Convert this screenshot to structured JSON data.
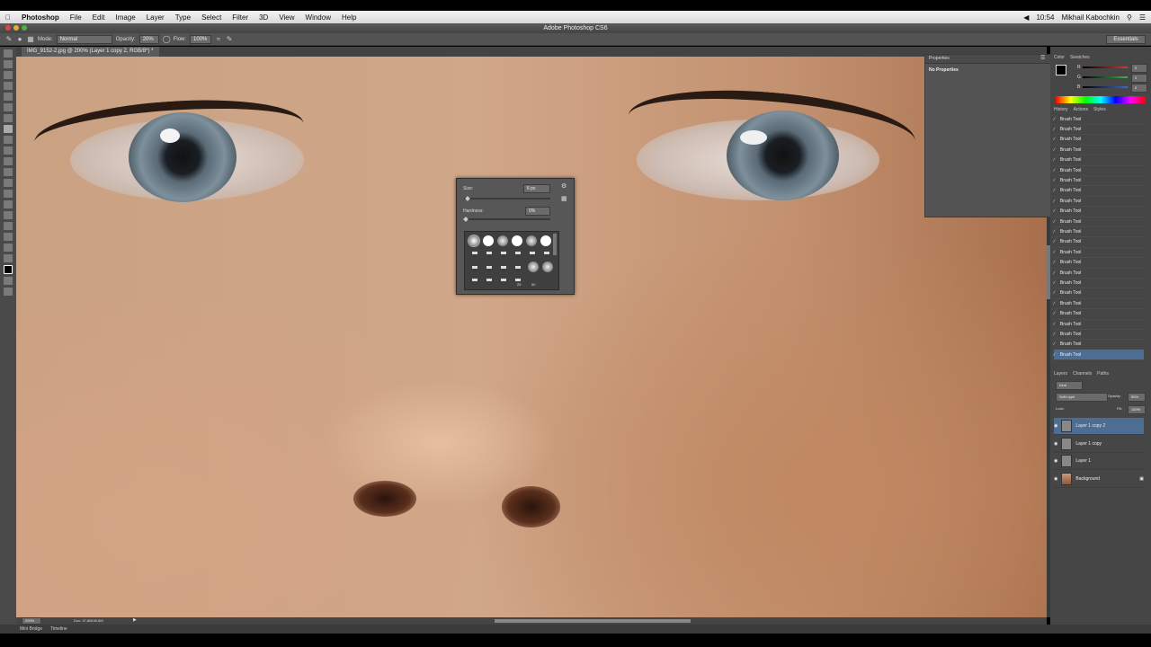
{
  "menubar": {
    "app": "Photoshop",
    "items": [
      "File",
      "Edit",
      "Image",
      "Layer",
      "Type",
      "Select",
      "Filter",
      "3D",
      "View",
      "Window",
      "Help"
    ],
    "time": "10:54",
    "user": "Mikhail Kabochkin"
  },
  "window_title": "Adobe Photoshop CS6",
  "options": {
    "mode_label": "Mode:",
    "mode_value": "Normal",
    "opacity_label": "Opacity:",
    "opacity_value": "20%",
    "flow_label": "Flow:",
    "flow_value": "100%",
    "workspace": "Essentials"
  },
  "document_tab": "IMG_9152-2.jpg @ 200% (Layer 1 copy 2, RGB/8*) *",
  "brush_picker": {
    "size_label": "Size:",
    "size_value": "6 px",
    "hardness_label": "Hardness:",
    "hardness_value": "0%",
    "size_level": 0.02,
    "hardness_level": 0.0,
    "grid_labels": [
      "25",
      "50"
    ]
  },
  "properties": {
    "title": "Properties",
    "message": "No Properties"
  },
  "color_panel": {
    "tabs": [
      "Color",
      "Swatches"
    ],
    "channels": [
      {
        "label": "R",
        "value": "0",
        "color": "#d23a3a"
      },
      {
        "label": "G",
        "value": "0",
        "color": "#3ab54a"
      },
      {
        "label": "B",
        "value": "0",
        "color": "#3a6ad2"
      }
    ]
  },
  "history": {
    "tabs": [
      "History",
      "Actions",
      "Styles"
    ],
    "items": [
      "Brush Tool",
      "Brush Tool",
      "Brush Tool",
      "Brush Tool",
      "Brush Tool",
      "Brush Tool",
      "Brush Tool",
      "Brush Tool",
      "Brush Tool",
      "Brush Tool",
      "Brush Tool",
      "Brush Tool",
      "Brush Tool",
      "Brush Tool",
      "Brush Tool",
      "Brush Tool",
      "Brush Tool",
      "Brush Tool",
      "Brush Tool",
      "Brush Tool",
      "Brush Tool",
      "Brush Tool",
      "Brush Tool",
      "Brush Tool"
    ]
  },
  "layers": {
    "tabs": [
      "Layers",
      "Channels",
      "Paths"
    ],
    "kind_label": "Kind",
    "blend_mode": "Soft Light",
    "opacity_label": "Opacity:",
    "opacity_value": "50%",
    "lock_label": "Lock:",
    "fill_label": "Fill:",
    "fill_value": "100%",
    "items": [
      "Layer 1 copy 2",
      "Layer 1 copy",
      "Layer 1",
      "Background"
    ]
  },
  "status": {
    "zoom": "200%",
    "doc": "Doc: 37,8M/40,8M"
  },
  "bottom_tabs": [
    "Mini Bridge",
    "Timeline"
  ]
}
